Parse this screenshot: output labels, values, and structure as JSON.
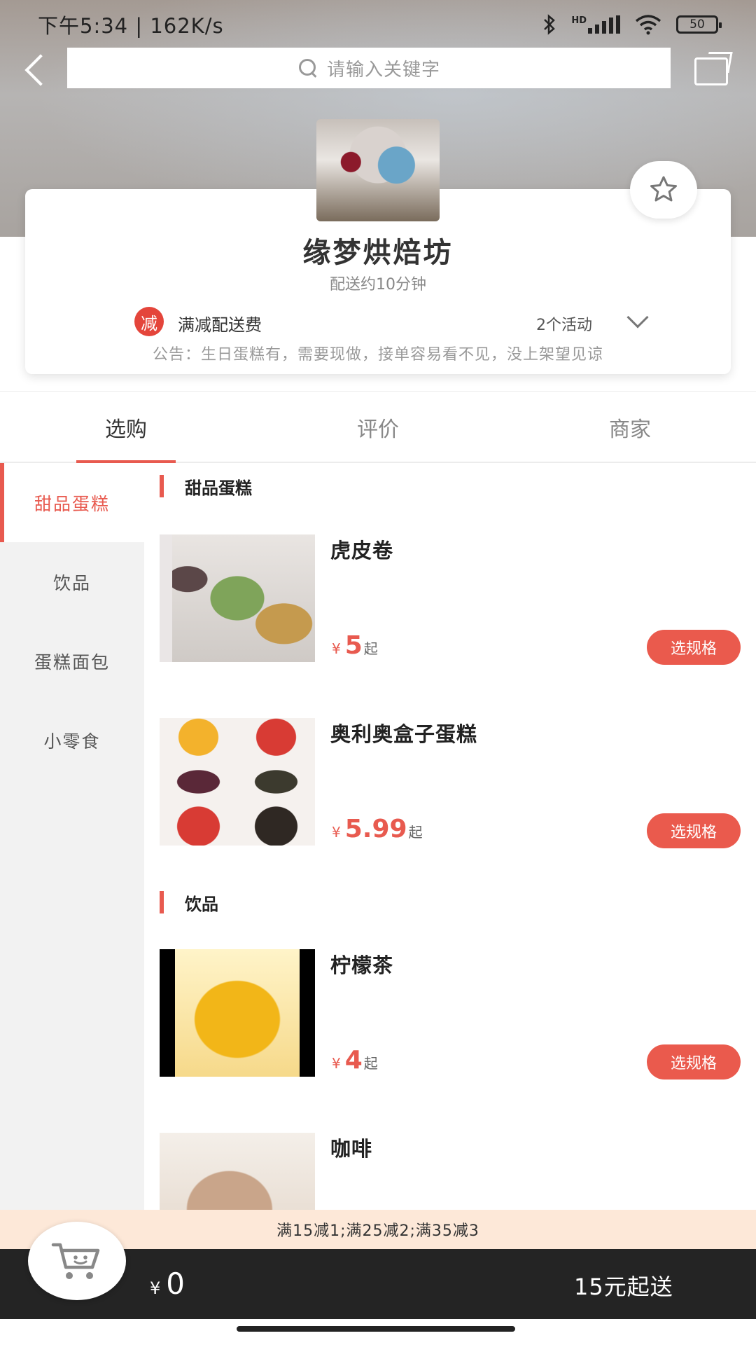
{
  "status_bar": {
    "time_speed": "下午5:34 | 162K/s",
    "bluetooth": "bluetooth-icon",
    "hd": "HD",
    "battery": "50"
  },
  "search": {
    "placeholder": "请输入关键字"
  },
  "shop": {
    "name": "缘梦烘焙坊",
    "delivery_time": "配送约10分钟",
    "promo_badge": "减",
    "promo_text": "满减配送费",
    "activity_count": "2个活动",
    "notice": "公告：生日蛋糕有，需要现做，接单容易看不见，没上架望见谅"
  },
  "tabs": [
    {
      "label": "选购"
    },
    {
      "label": "评价"
    },
    {
      "label": "商家"
    }
  ],
  "categories": [
    {
      "label": "甜品蛋糕"
    },
    {
      "label": "饮品"
    },
    {
      "label": "蛋糕面包"
    },
    {
      "label": "小零食"
    }
  ],
  "sections": [
    {
      "title": "甜品蛋糕"
    },
    {
      "title": "饮品"
    }
  ],
  "items": [
    {
      "name": "虎皮卷",
      "currency": "¥",
      "price": "5",
      "suffix": "起",
      "button": "选规格"
    },
    {
      "name": "奥利奥盒子蛋糕",
      "currency": "¥",
      "price": "5.99",
      "suffix": "起",
      "button": "选规格"
    },
    {
      "name": "柠檬茶",
      "currency": "¥",
      "price": "4",
      "suffix": "起",
      "button": "选规格"
    },
    {
      "name": "咖啡"
    }
  ],
  "promo_strip": "满15减1;满25减2;满35减3",
  "cart": {
    "currency": "¥",
    "total": "0",
    "min_order": "15元起送"
  },
  "colors": {
    "accent": "#e85a4f",
    "cart_bar": "#242424",
    "promo_strip_bg": "#fde8d8"
  }
}
